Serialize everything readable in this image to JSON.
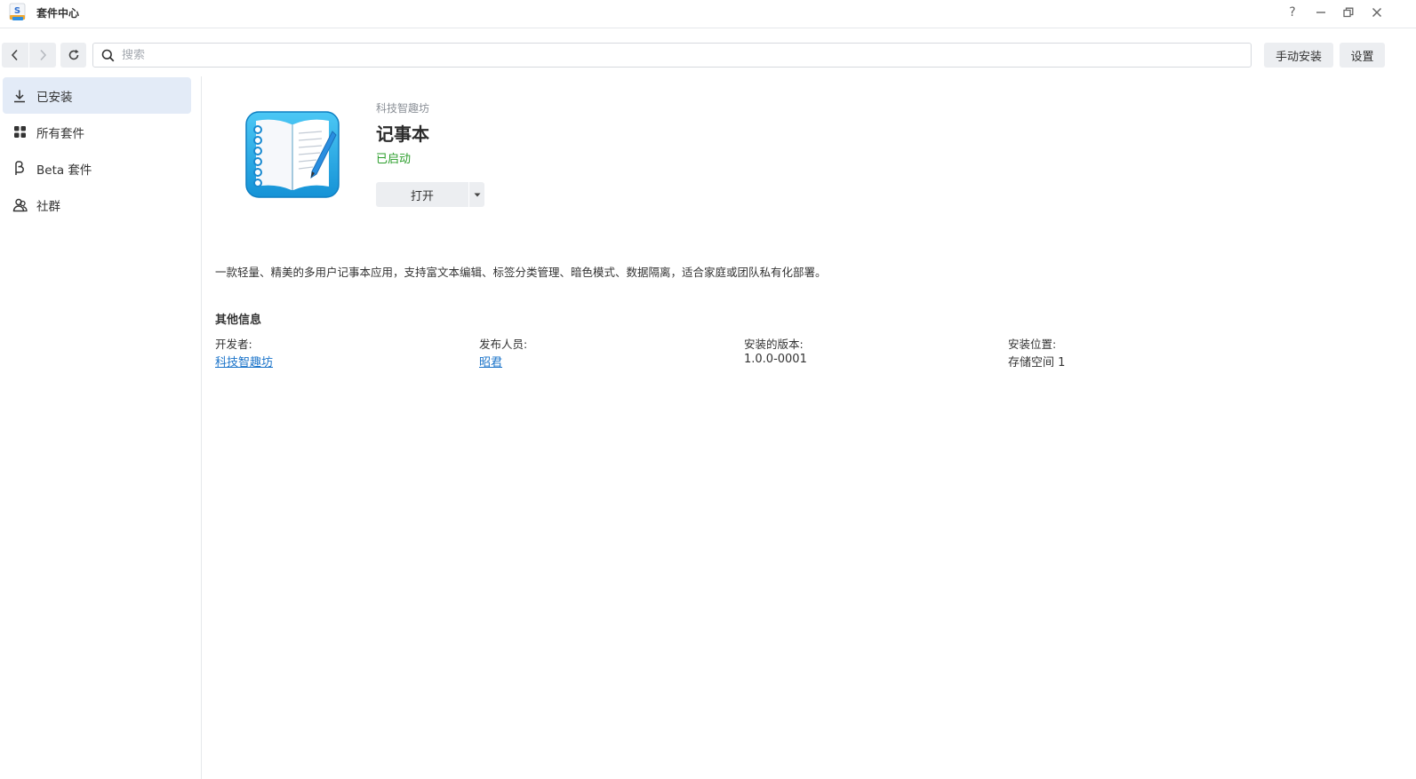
{
  "window": {
    "title": "套件中心",
    "help_label": "?",
    "minimize_label": "—",
    "close_label": "✕"
  },
  "toolbar": {
    "search_placeholder": "搜索",
    "manual_install_label": "手动安装",
    "settings_label": "设置"
  },
  "sidebar": {
    "items": [
      {
        "label": "已安装",
        "icon": "download-icon",
        "active": true
      },
      {
        "label": "所有套件",
        "icon": "grid-icon",
        "active": false
      },
      {
        "label": "Beta 套件",
        "icon": "beta-icon",
        "active": false
      },
      {
        "label": "社群",
        "icon": "community-icon",
        "active": false
      }
    ]
  },
  "package": {
    "developer_small": "科技智趣坊",
    "name": "记事本",
    "status": "已启动",
    "open_label": "打开",
    "description": "一款轻量、精美的多用户记事本应用，支持富文本编辑、标签分类管理、暗色模式、数据隔离，适合家庭或团队私有化部署。"
  },
  "other_info": {
    "title": "其他信息",
    "fields": [
      {
        "label": "开发者:",
        "value": "科技智趣坊",
        "link": true
      },
      {
        "label": "发布人员:",
        "value": "昭君",
        "link": true
      },
      {
        "label": "安装的版本:",
        "value": "1.0.0-0001",
        "link": false
      },
      {
        "label": "安装位置:",
        "value": "存储空间 1",
        "link": false
      }
    ]
  },
  "colors": {
    "accent": "#1a73c9",
    "status_green": "#2a9d2a",
    "sidebar_active": "#e3ebf7",
    "button_bg": "#eceef1"
  }
}
